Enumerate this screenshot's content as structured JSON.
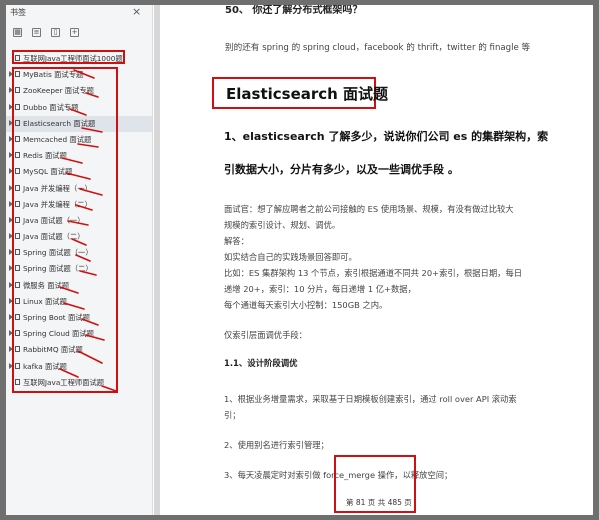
{
  "sidebar": {
    "title": "书签",
    "close": "×",
    "tools": [
      "grid-icon",
      "list-icon",
      "bookmark-icon",
      "bookmark-add-icon"
    ],
    "items": [
      {
        "label": "互联网Java工程师面试1000题"
      },
      {
        "label": "MyBatis 面试专题"
      },
      {
        "label": "ZooKeeper 面试专题"
      },
      {
        "label": "Dubbo 面试专题"
      },
      {
        "label": "Elasticsearch 面试题"
      },
      {
        "label": "Memcached 面试题"
      },
      {
        "label": "Redis 面试题"
      },
      {
        "label": "MySQL 面试题"
      },
      {
        "label": "Java 并发编程（一）"
      },
      {
        "label": "Java 并发编程（二）"
      },
      {
        "label": "Java 面试题（一）"
      },
      {
        "label": "Java 面试题（二）"
      },
      {
        "label": "Spring 面试题（一）"
      },
      {
        "label": "Spring 面试题（二）"
      },
      {
        "label": "微服务 面试题"
      },
      {
        "label": "Linux 面试题"
      },
      {
        "label": "Spring Boot 面试题"
      },
      {
        "label": "Spring Cloud 面试题"
      },
      {
        "label": "RabbitMQ 面试题"
      },
      {
        "label": "kafka 面试题"
      },
      {
        "label": "互联网Java工程师面试题"
      }
    ]
  },
  "document": {
    "top_cut": "50、 你还了解分布式框架吗？",
    "para0": "别的还有 spring 的 spring cloud，facebook 的 thrift，twitter 的 finagle 等",
    "section_title": "Elasticsearch  面试题",
    "q1_line1": "1、elasticsearch 了解多少，说说你们公司 es 的集群架构，索",
    "q1_line2": "引数据大小，分片有多少，以及一些调优手段 。",
    "body_lines": [
      "面试官：想了解应聘者之前公司接触的 ES 使用场景、规模，有没有做过比较大",
      "规模的索引设计、规划、调优。",
      "解答：",
      "如实结合自己的实践场景回答即可。",
      "比如：ES 集群架构 13 个节点，索引根据通道不同共 20+索引，根据日期，每日",
      "递增 20+，索引：10 分片，每日递增 1 亿+数据，",
      "每个通道每天索引大小控制：150GB 之内。",
      "仅索引层面调优手段：",
      "1.1、设计阶段调优",
      "1、根据业务增量需求，采取基于日期模板创建索引，通过 roll over API 滚动索",
      "引；",
      "2、使用别名进行索引管理；",
      "3、每天凌晨定时对索引做 force_merge 操作，以释放空间；"
    ],
    "footer": "第 81 页 共 485 页"
  }
}
